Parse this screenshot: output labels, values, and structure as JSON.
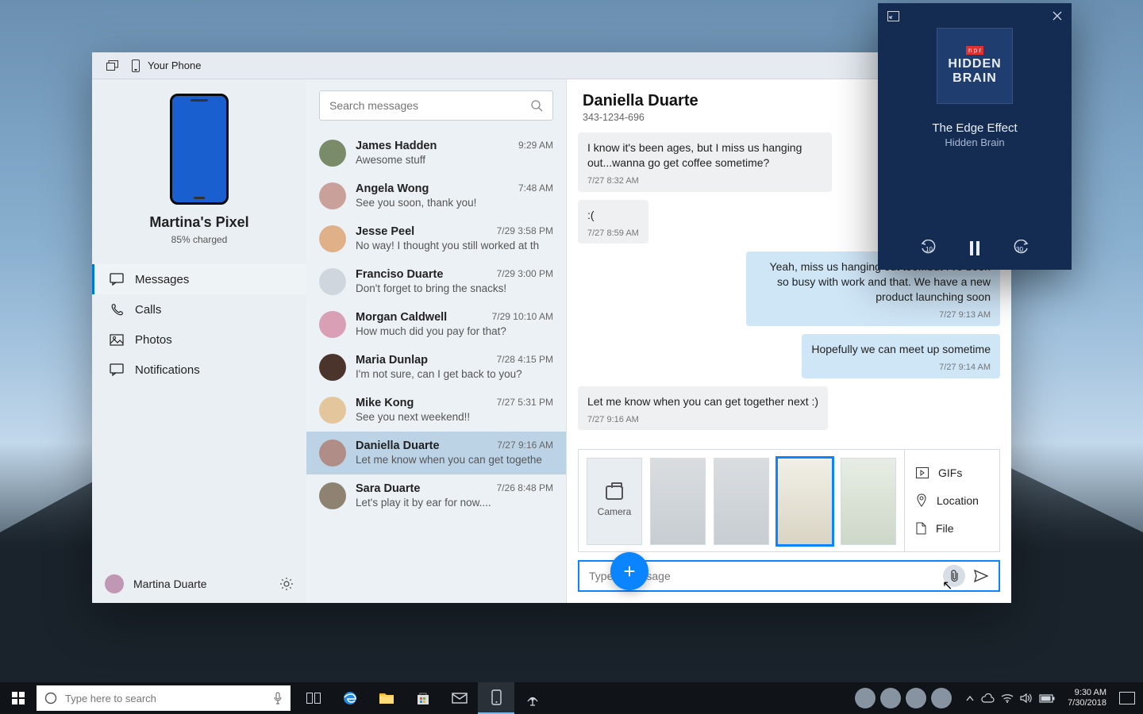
{
  "window": {
    "title": "Your Phone"
  },
  "device": {
    "name": "Martina's Pixel",
    "status": "85% charged"
  },
  "nav": {
    "items": [
      {
        "label": "Messages",
        "active": true
      },
      {
        "label": "Calls"
      },
      {
        "label": "Photos"
      },
      {
        "label": "Notifications"
      }
    ]
  },
  "user": {
    "name": "Martina Duarte"
  },
  "search": {
    "placeholder": "Search messages"
  },
  "conversations": [
    {
      "name": "James Hadden",
      "preview": "Awesome stuff",
      "time": "9:29 AM"
    },
    {
      "name": "Angela Wong",
      "preview": "See you soon, thank you!",
      "time": "7:48 AM"
    },
    {
      "name": "Jesse Peel",
      "preview": "No way! I thought you still worked at th",
      "time": "7/29 3:58 PM"
    },
    {
      "name": "Franciso Duarte",
      "preview": "Don't forget to bring the snacks!",
      "time": "7/29 3:00 PM"
    },
    {
      "name": "Morgan Caldwell",
      "preview": "How much did you pay for that?",
      "time": "7/29 10:10 AM"
    },
    {
      "name": "Maria Dunlap",
      "preview": "I'm not sure, can I get back to you?",
      "time": "7/28 4:15 PM"
    },
    {
      "name": "Mike Kong",
      "preview": "See you next weekend!!",
      "time": "7/27 5:31 PM"
    },
    {
      "name": "Daniella Duarte",
      "preview": "Let me know when you can get togethe",
      "time": "7/27 9:16 AM",
      "active": true
    },
    {
      "name": "Sara Duarte",
      "preview": "Let's play it by ear for now....",
      "time": "7/26 8:48 PM"
    }
  ],
  "chat": {
    "name": "Daniella Duarte",
    "number": "343-1234-696",
    "messages": [
      {
        "dir": "in",
        "body": "I know it's been ages, but I miss us hanging out...wanna go get coffee sometime?",
        "ts": "7/27 8:32 AM"
      },
      {
        "dir": "in",
        "body": ":(",
        "ts": "7/27 8:59 AM"
      },
      {
        "dir": "out",
        "body": "Yeah, miss us hanging out too...but I've been so busy with work and that. We have a new product launching soon",
        "ts": "7/27 9:13 AM"
      },
      {
        "dir": "out",
        "body": "Hopefully we can meet up sometime",
        "ts": "7/27 9:14 AM"
      },
      {
        "dir": "in",
        "body": "Let me know when you can get together next :)",
        "ts": "7/27 9:16 AM"
      }
    ],
    "attach": {
      "camera_label": "Camera",
      "menu": {
        "gifs": "GIFs",
        "location": "Location",
        "file": "File"
      }
    },
    "compose_placeholder": "Type a message"
  },
  "media": {
    "brand": "n p r",
    "art_line1": "HIDDEN",
    "art_line2": "BRAIN",
    "track": "The Edge Effect",
    "artist": "Hidden Brain",
    "back_secs": "10",
    "fwd_secs": "30"
  },
  "taskbar": {
    "search_placeholder": "Type here to search",
    "clock": {
      "time": "9:30 AM",
      "date": "7/30/2018"
    }
  }
}
